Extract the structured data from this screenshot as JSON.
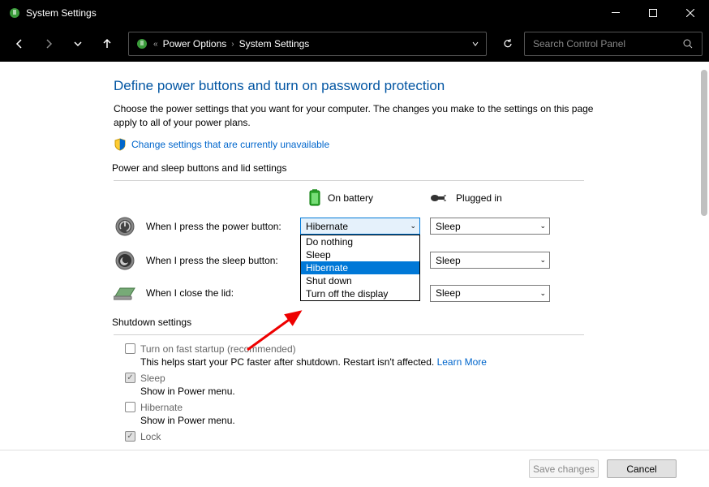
{
  "titlebar": {
    "title": "System Settings"
  },
  "breadcrumb": {
    "item1": "Power Options",
    "item2": "System Settings"
  },
  "search": {
    "placeholder": "Search Control Panel"
  },
  "page": {
    "heading": "Define power buttons and turn on password protection",
    "desc": "Choose the power settings that you want for your computer. The changes you make to the settings on this page apply to all of your power plans.",
    "change_link": "Change settings that are currently unavailable",
    "section1": "Power and sleep buttons and lid settings",
    "col_battery": "On battery",
    "col_plugged": "Plugged in",
    "row_power": "When I press the power button:",
    "row_sleep": "When I press the sleep button:",
    "row_lid": "When I close the lid:",
    "power_battery_value": "Hibernate",
    "power_plugged_value": "Sleep",
    "sleep_battery_value": "",
    "sleep_plugged_value": "Sleep",
    "lid_battery_value": "",
    "lid_plugged_value": "Sleep",
    "dropdown": {
      "opt0": "Do nothing",
      "opt1": "Sleep",
      "opt2": "Hibernate",
      "opt3": "Shut down",
      "opt4": "Turn off the display"
    },
    "section2": "Shutdown settings",
    "fast_title": "Turn on fast startup (recommended)",
    "fast_desc": "This helps start your PC faster after shutdown. Restart isn't affected. ",
    "learn_more": "Learn More",
    "sleep_title": "Sleep",
    "sleep_desc": "Show in Power menu.",
    "hib_title": "Hibernate",
    "hib_desc": "Show in Power menu.",
    "lock_title": "Lock"
  },
  "footer": {
    "save": "Save changes",
    "cancel": "Cancel"
  }
}
